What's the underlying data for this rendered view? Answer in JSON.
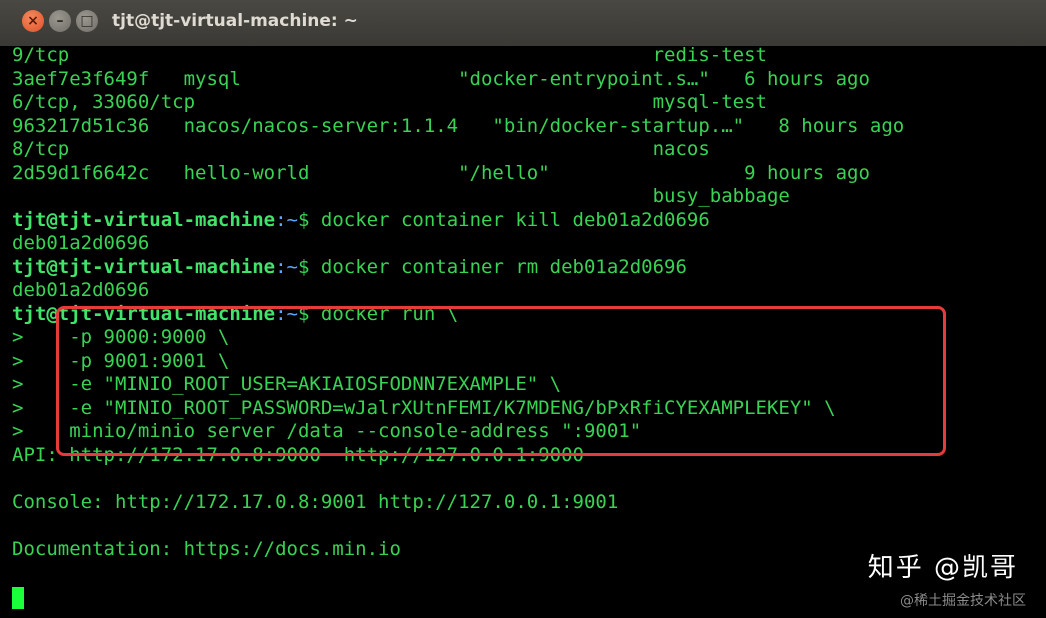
{
  "window": {
    "title": "tjt@tjt-virtual-machine: ~"
  },
  "terminal": {
    "lines": [
      {
        "text": "9/tcp                                                   redis-test"
      },
      {
        "text": "3aef7e3f649f   mysql                   \"docker-entrypoint.s…\"   6 hours ago"
      },
      {
        "text": "6/tcp, 33060/tcp                                        mysql-test"
      },
      {
        "text": "963217d51c36   nacos/nacos-server:1.1.4   \"bin/docker-startup.…\"   8 hours ago"
      },
      {
        "text": "8/tcp                                                   nacos"
      },
      {
        "text": "2d59d1f6642c   hello-world             \"/hello\"                 9 hours ago"
      },
      {
        "text": "                                                        busy_babbage"
      },
      {
        "user": "tjt@tjt-virtual-machine",
        "path": ":~",
        "cmd": "$ docker container kill deb01a2d0696"
      },
      {
        "text": "deb01a2d0696"
      },
      {
        "user": "tjt@tjt-virtual-machine",
        "path": ":~",
        "cmd": "$ docker container rm deb01a2d0696"
      },
      {
        "text": "deb01a2d0696"
      },
      {
        "user": "tjt@tjt-virtual-machine",
        "path": ":~",
        "cmd": "$ docker run \\"
      },
      {
        "text": ">    -p 9000:9000 \\"
      },
      {
        "text": ">    -p 9001:9001 \\"
      },
      {
        "text": ">    -e \"MINIO_ROOT_USER=AKIAIOSFODNN7EXAMPLE\" \\"
      },
      {
        "text": ">    -e \"MINIO_ROOT_PASSWORD=wJalrXUtnFEMI/K7MDENG/bPxRfiCYEXAMPLEKEY\" \\"
      },
      {
        "text": ">    minio/minio server /data --console-address \":9001\""
      },
      {
        "text": "API: http://172.17.0.8:9000  http://127.0.0.1:9000"
      },
      {
        "text": ""
      },
      {
        "text": "Console: http://172.17.0.8:9001 http://127.0.0.1:9001"
      },
      {
        "text": ""
      },
      {
        "text": "Documentation: https://docs.min.io"
      }
    ]
  },
  "watermark": {
    "main": "知乎 @凯哥",
    "sub": "@稀土掘金技术社区"
  },
  "colors": {
    "terminal_bg": "#000000",
    "terminal_fg": "#39d353",
    "highlight_border": "#e53b3b"
  }
}
